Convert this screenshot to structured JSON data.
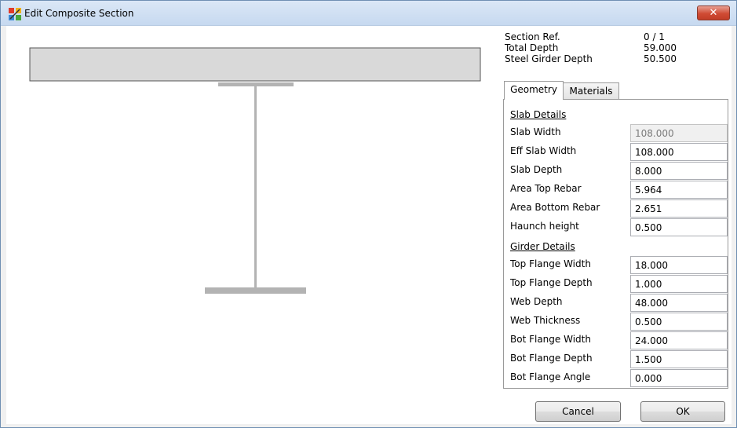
{
  "window": {
    "title": "Edit Composite Section",
    "close_glyph": "✕"
  },
  "colors": {
    "slab_fill": "#d9d9d9",
    "slab_stroke": "#555555",
    "girder_fill": "#b3b3b3"
  },
  "info": {
    "section_ref_label": "Section Ref.",
    "section_ref_value": "0 / 1",
    "total_depth_label": "Total Depth",
    "total_depth_value": "59.000",
    "steel_girder_depth_label": "Steel Girder Depth",
    "steel_girder_depth_value": "50.500"
  },
  "tabs": {
    "geometry": "Geometry",
    "materials": "Materials",
    "active": "Geometry"
  },
  "slab": {
    "heading": "Slab Details",
    "slab_width_label": "Slab Width",
    "slab_width_value": "108.000",
    "eff_slab_width_label": "Eff Slab Width",
    "eff_slab_width_value": "108.000",
    "slab_depth_label": "Slab Depth",
    "slab_depth_value": "8.000",
    "area_top_rebar_label": "Area Top Rebar",
    "area_top_rebar_value": "5.964",
    "area_bottom_rebar_label": "Area Bottom Rebar",
    "area_bottom_rebar_value": "2.651",
    "haunch_height_label": "Haunch height",
    "haunch_height_value": "0.500"
  },
  "girder": {
    "heading": "Girder Details",
    "top_flange_width_label": "Top Flange Width",
    "top_flange_width_value": "18.000",
    "top_flange_depth_label": "Top Flange Depth",
    "top_flange_depth_value": "1.000",
    "web_depth_label": "Web Depth",
    "web_depth_value": "48.000",
    "web_thickness_label": "Web Thickness",
    "web_thickness_value": "0.500",
    "bot_flange_width_label": "Bot Flange Width",
    "bot_flange_width_value": "24.000",
    "bot_flange_depth_label": "Bot Flange Depth",
    "bot_flange_depth_value": "1.500",
    "bot_flange_angle_label": "Bot Flange Angle",
    "bot_flange_angle_value": "0.000"
  },
  "buttons": {
    "cancel": "Cancel",
    "ok": "OK"
  }
}
